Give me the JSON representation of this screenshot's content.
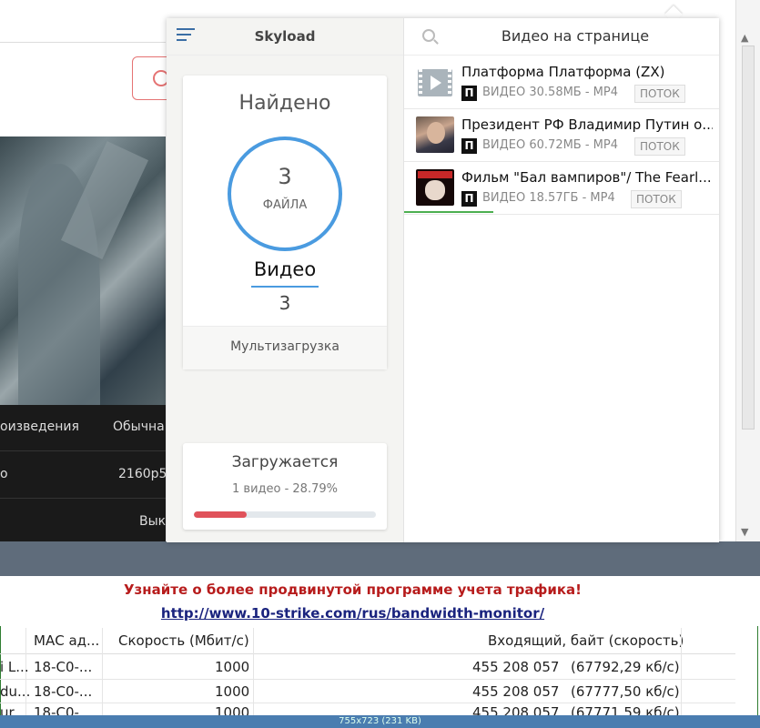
{
  "popup": {
    "brand": "Skyload",
    "found": {
      "title": "Найдено",
      "count": "3",
      "count_label": "ФАЙЛА",
      "category": "Видео",
      "category_count": "3",
      "multi_label": "Мультизагрузка"
    },
    "download": {
      "title": "Загружается",
      "subtitle": "1 видео - 28.79%",
      "progress": 0.2879
    },
    "list": {
      "title": "Видео на странице",
      "items": [
        {
          "title": "Платформа Платформа (ZX)",
          "badge": "П",
          "meta": "ВИДЕО 30.58МБ - MP4",
          "stream": "ПОТОК",
          "thumb": "video-file-icon"
        },
        {
          "title": "Президент РФ Владимир Путин о...",
          "badge": "П",
          "meta": "ВИДЕО 60.72МБ - MP4",
          "stream": "ПОТОК",
          "thumb": "putin-thumbnail"
        },
        {
          "title": "Фильм \"Бал вампиров\"/ The Fearl...",
          "badge": "П",
          "meta": "ВИДЕО 18.57ГБ - MP4",
          "stream": "ПОТОК",
          "thumb": "film-thumbnail"
        }
      ]
    }
  },
  "background": {
    "video_rows": [
      {
        "left": "оизведения",
        "right": "Обычна"
      },
      {
        "left": "о",
        "right": "2160p5"
      },
      {
        "left": "",
        "right": "Вык"
      }
    ],
    "promo": {
      "title": "Узнайте о более продвинутой программе учета трафика!",
      "link": "http://www.10-strike.com/rus/bandwidth-monitor/"
    },
    "table": {
      "headers": [
        "МАС ад...",
        "Скорость (Мбит/с)",
        "Входящий, байт (скорость)"
      ],
      "rows": [
        {
          "c0": "і L...",
          "mac": "18-C0-...",
          "speed": "1000",
          "bytes": "455 208 057",
          "rate": "(67792,29 кб/с)"
        },
        {
          "c0": "du...",
          "mac": "18-C0-...",
          "speed": "1000",
          "bytes": "455 208 057",
          "rate": "(67777,50 кб/с)"
        },
        {
          "c0": "ur...",
          "mac": "18-C0-...",
          "speed": "1000",
          "bytes": "455 208 057",
          "rate": "(67771,59 кб/с)"
        }
      ]
    },
    "status": "755x723 (231 KB)"
  },
  "colors": {
    "accent": "#4a9be0",
    "progress": "#e0525a",
    "promo_title": "#b71c1c"
  }
}
